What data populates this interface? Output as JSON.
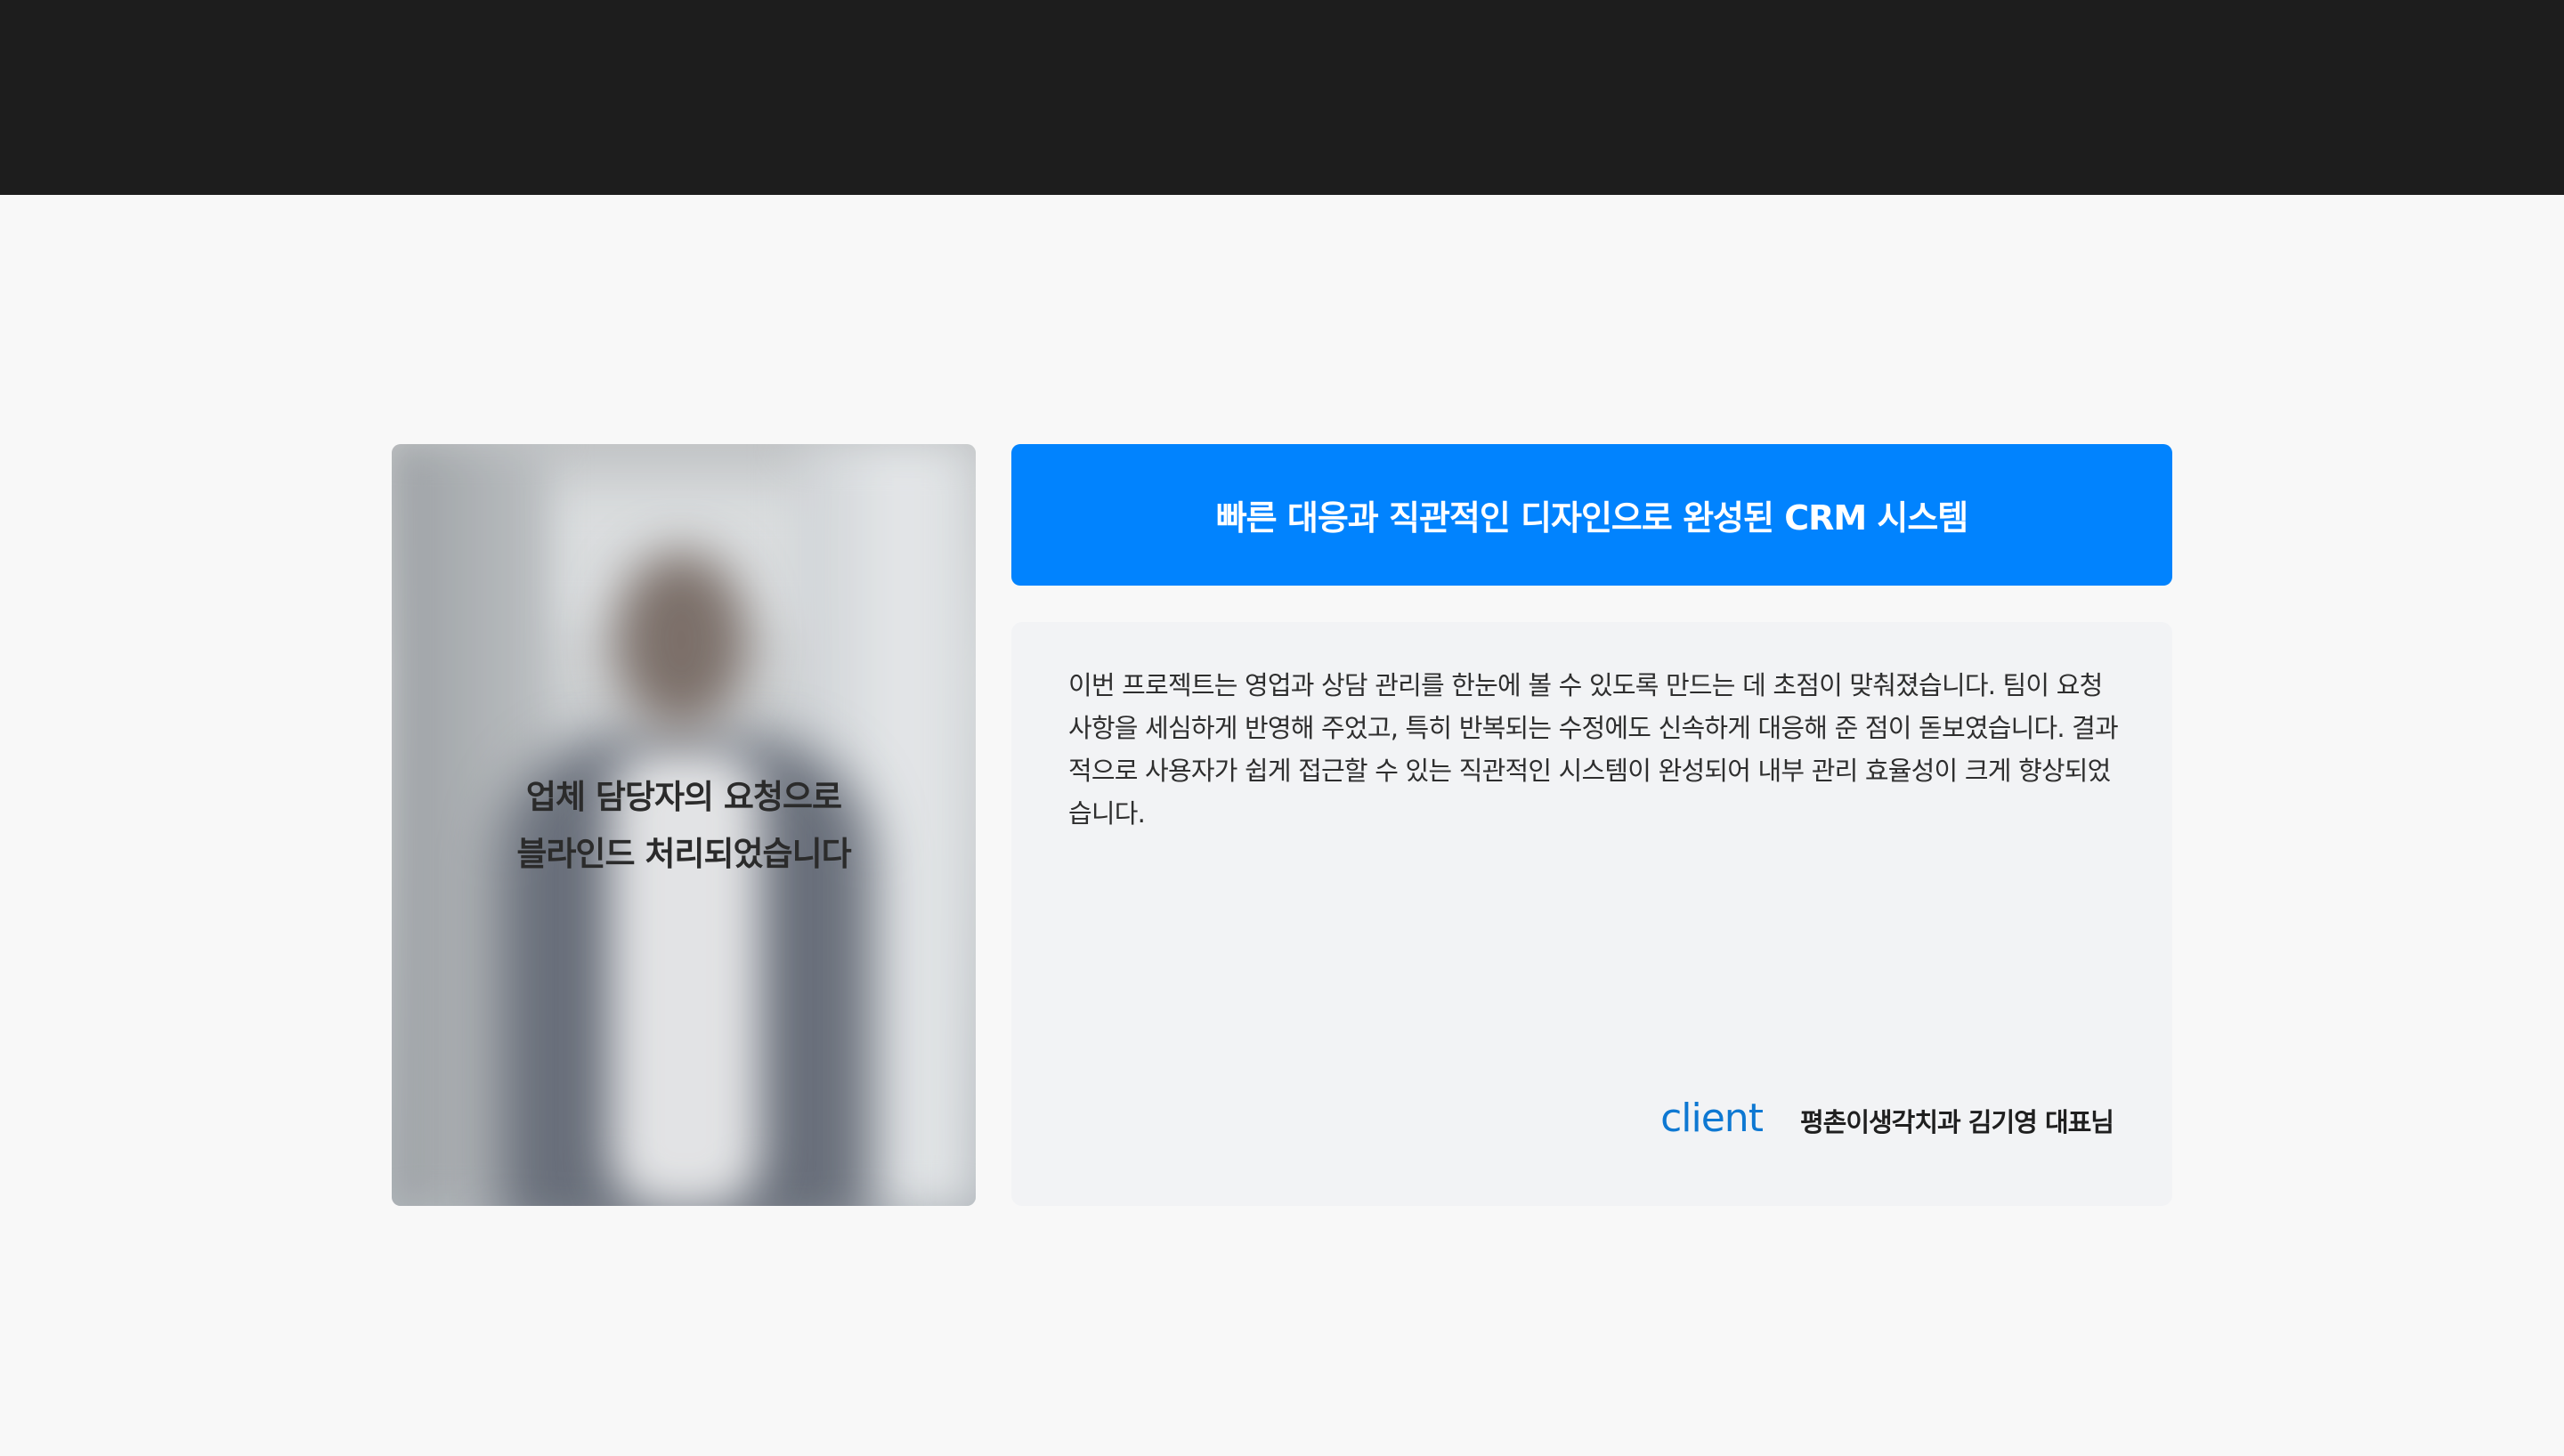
{
  "photo": {
    "caption_line1": "업체 담당자의 요청으로",
    "caption_line2": "블라인드 처리되었습니다"
  },
  "testimonial": {
    "headline": "빠른 대응과 직관적인 디자인으로 완성된 CRM 시스템",
    "body": "이번 프로젝트는 영업과 상담 관리를 한눈에 볼 수 있도록 만드는 데 초점이 맞춰졌습니다. 팀이 요청 사항을 세심하게 반영해 주었고, 특히 반복되는 수정에도 신속하게 대응해 준 점이 돋보였습니다. 결과적으로 사용자가 쉽게 접근할 수 있는 직관적인 시스템이 완성되어 내부 관리 효율성이 크게 향상되었습니다.",
    "client_label": "client",
    "client_name": "평촌이생각치과 김기영 대표님"
  },
  "colors": {
    "header_bg": "#1d1d1d",
    "accent_blue": "#0183fe",
    "client_label_blue": "#0e78d2",
    "card_bg": "#f2f3f5",
    "page_bg": "#f8f8f8"
  }
}
